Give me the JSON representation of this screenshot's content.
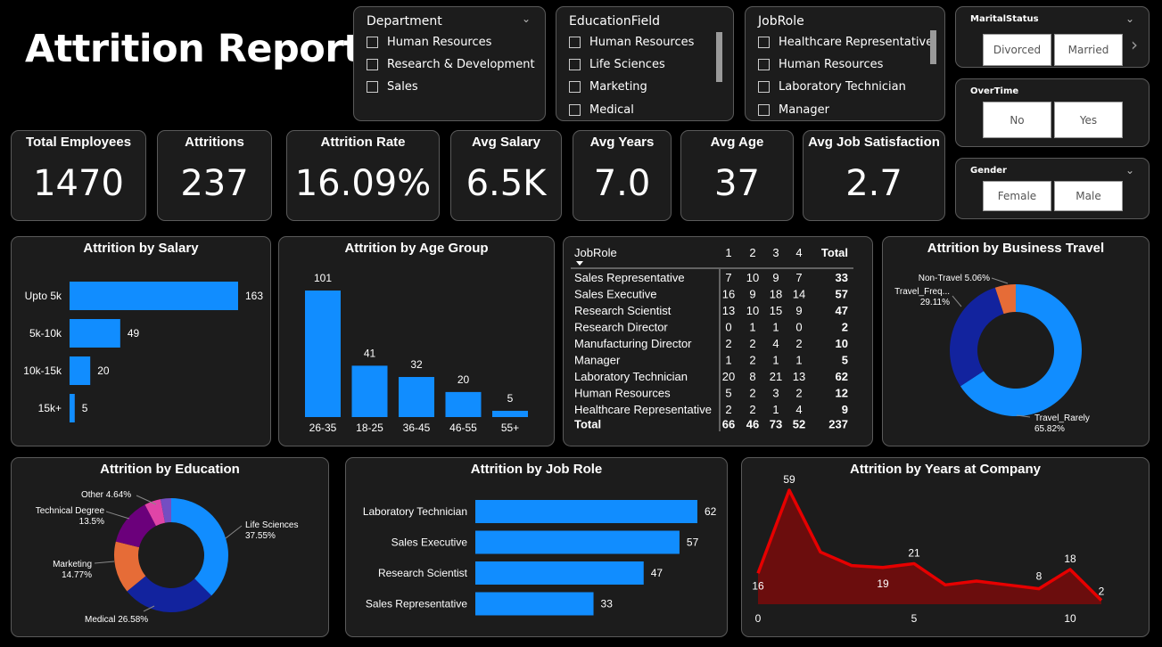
{
  "title": "Attrition Report",
  "slicers": {
    "department": {
      "label": "Department",
      "items": [
        "Human Resources",
        "Research & Development",
        "Sales"
      ]
    },
    "education_field": {
      "label": "EducationField",
      "items": [
        "Human Resources",
        "Life Sciences",
        "Marketing",
        "Medical"
      ]
    },
    "job_role": {
      "label": "JobRole",
      "items": [
        "Healthcare Representative",
        "Human Resources",
        "Laboratory Technician",
        "Manager"
      ]
    },
    "marital_status": {
      "label": "MaritalStatus",
      "options": [
        "Divorced",
        "Married"
      ]
    },
    "overtime": {
      "label": "OverTime",
      "options": [
        "No",
        "Yes"
      ]
    },
    "gender": {
      "label": "Gender",
      "options": [
        "Female",
        "Male"
      ]
    }
  },
  "kpis": [
    {
      "label": "Total Employees",
      "value": "1470"
    },
    {
      "label": "Attritions",
      "value": "237"
    },
    {
      "label": "Attrition Rate",
      "value": "16.09%"
    },
    {
      "label": "Avg Salary",
      "value": "6.5K"
    },
    {
      "label": "Avg Years",
      "value": "7.0"
    },
    {
      "label": "Avg Age",
      "value": "37"
    },
    {
      "label": "Avg Job Satisfaction",
      "value": "2.7"
    }
  ],
  "matrix": {
    "headers": [
      "JobRole",
      "1",
      "2",
      "3",
      "4",
      "Total"
    ],
    "rows": [
      [
        "Sales Representative",
        "7",
        "10",
        "9",
        "7",
        "33"
      ],
      [
        "Sales Executive",
        "16",
        "9",
        "18",
        "14",
        "57"
      ],
      [
        "Research Scientist",
        "13",
        "10",
        "15",
        "9",
        "47"
      ],
      [
        "Research Director",
        "0",
        "1",
        "1",
        "0",
        "2"
      ],
      [
        "Manufacturing Director",
        "2",
        "2",
        "4",
        "2",
        "10"
      ],
      [
        "Manager",
        "1",
        "2",
        "1",
        "1",
        "5"
      ],
      [
        "Laboratory Technician",
        "20",
        "8",
        "21",
        "13",
        "62"
      ],
      [
        "Human Resources",
        "5",
        "2",
        "3",
        "2",
        "12"
      ],
      [
        "Healthcare Representative",
        "2",
        "2",
        "1",
        "4",
        "9"
      ]
    ],
    "total": [
      "Total",
      "66",
      "46",
      "73",
      "52",
      "237"
    ]
  },
  "colors": {
    "bar": "#118dff",
    "line": "#e60000",
    "area": "#6b0d0d",
    "panel": "#1c1c1c",
    "border": "#5a5a5a"
  },
  "chart_data": [
    {
      "id": "salary",
      "type": "bar",
      "orientation": "horizontal",
      "title": "Attrition by Salary",
      "categories": [
        "Upto 5k",
        "5k-10k",
        "10k-15k",
        "15k+"
      ],
      "values": [
        163,
        49,
        20,
        5
      ]
    },
    {
      "id": "age",
      "type": "bar",
      "orientation": "vertical",
      "title": "Attrition by Age Group",
      "categories": [
        "26-35",
        "18-25",
        "36-45",
        "46-55",
        "55+"
      ],
      "values": [
        101,
        41,
        32,
        20,
        5
      ]
    },
    {
      "id": "travel",
      "type": "pie",
      "title": "Attrition by Business Travel",
      "slices": [
        {
          "name": "Travel_Rarely",
          "pct": "65.82%",
          "value": 65.82,
          "color": "#118dff"
        },
        {
          "name": "Travel_Freq...",
          "pct": "29.11%",
          "value": 29.11,
          "color": "#12239e"
        },
        {
          "name": "Non-Travel",
          "pct": "5.06%",
          "value": 5.06,
          "color": "#e66c37"
        }
      ]
    },
    {
      "id": "education",
      "type": "pie",
      "title": "Attrition by Education",
      "slices": [
        {
          "name": "Life Sciences",
          "pct": "37.55%",
          "value": 37.55,
          "color": "#118dff"
        },
        {
          "name": "Medical",
          "pct": "26.58%",
          "value": 26.58,
          "color": "#12239e"
        },
        {
          "name": "Marketing",
          "pct": "14.77%",
          "value": 14.77,
          "color": "#e66c37"
        },
        {
          "name": "Technical Degree",
          "pct": "13.5%",
          "value": 13.5,
          "color": "#6b007b"
        },
        {
          "name": "Other",
          "pct": "4.64%",
          "value": 4.64,
          "color": "#e044a7"
        },
        {
          "name": "",
          "pct": "",
          "value": 3.0,
          "color": "#744ec2"
        }
      ]
    },
    {
      "id": "jobrole",
      "type": "bar",
      "orientation": "horizontal",
      "title": "Attrition by Job Role",
      "categories": [
        "Laboratory Technician",
        "Sales Executive",
        "Research Scientist",
        "Sales Representative"
      ],
      "values": [
        62,
        57,
        47,
        33
      ]
    },
    {
      "id": "years",
      "type": "area",
      "title": "Attrition by Years at Company",
      "x": [
        0,
        1,
        2,
        3,
        4,
        5,
        6,
        7,
        8,
        9,
        10,
        11
      ],
      "y": [
        16,
        59,
        27,
        20,
        19,
        21,
        10,
        12,
        10,
        8,
        18,
        2
      ],
      "labels": {
        "0": "16",
        "1": "59",
        "4": "19",
        "5": "21",
        "9": "8",
        "10": "18",
        "11": "2"
      },
      "xticks": [
        "0",
        "5",
        "10"
      ],
      "xtick_values": [
        0,
        5,
        10
      ]
    }
  ]
}
